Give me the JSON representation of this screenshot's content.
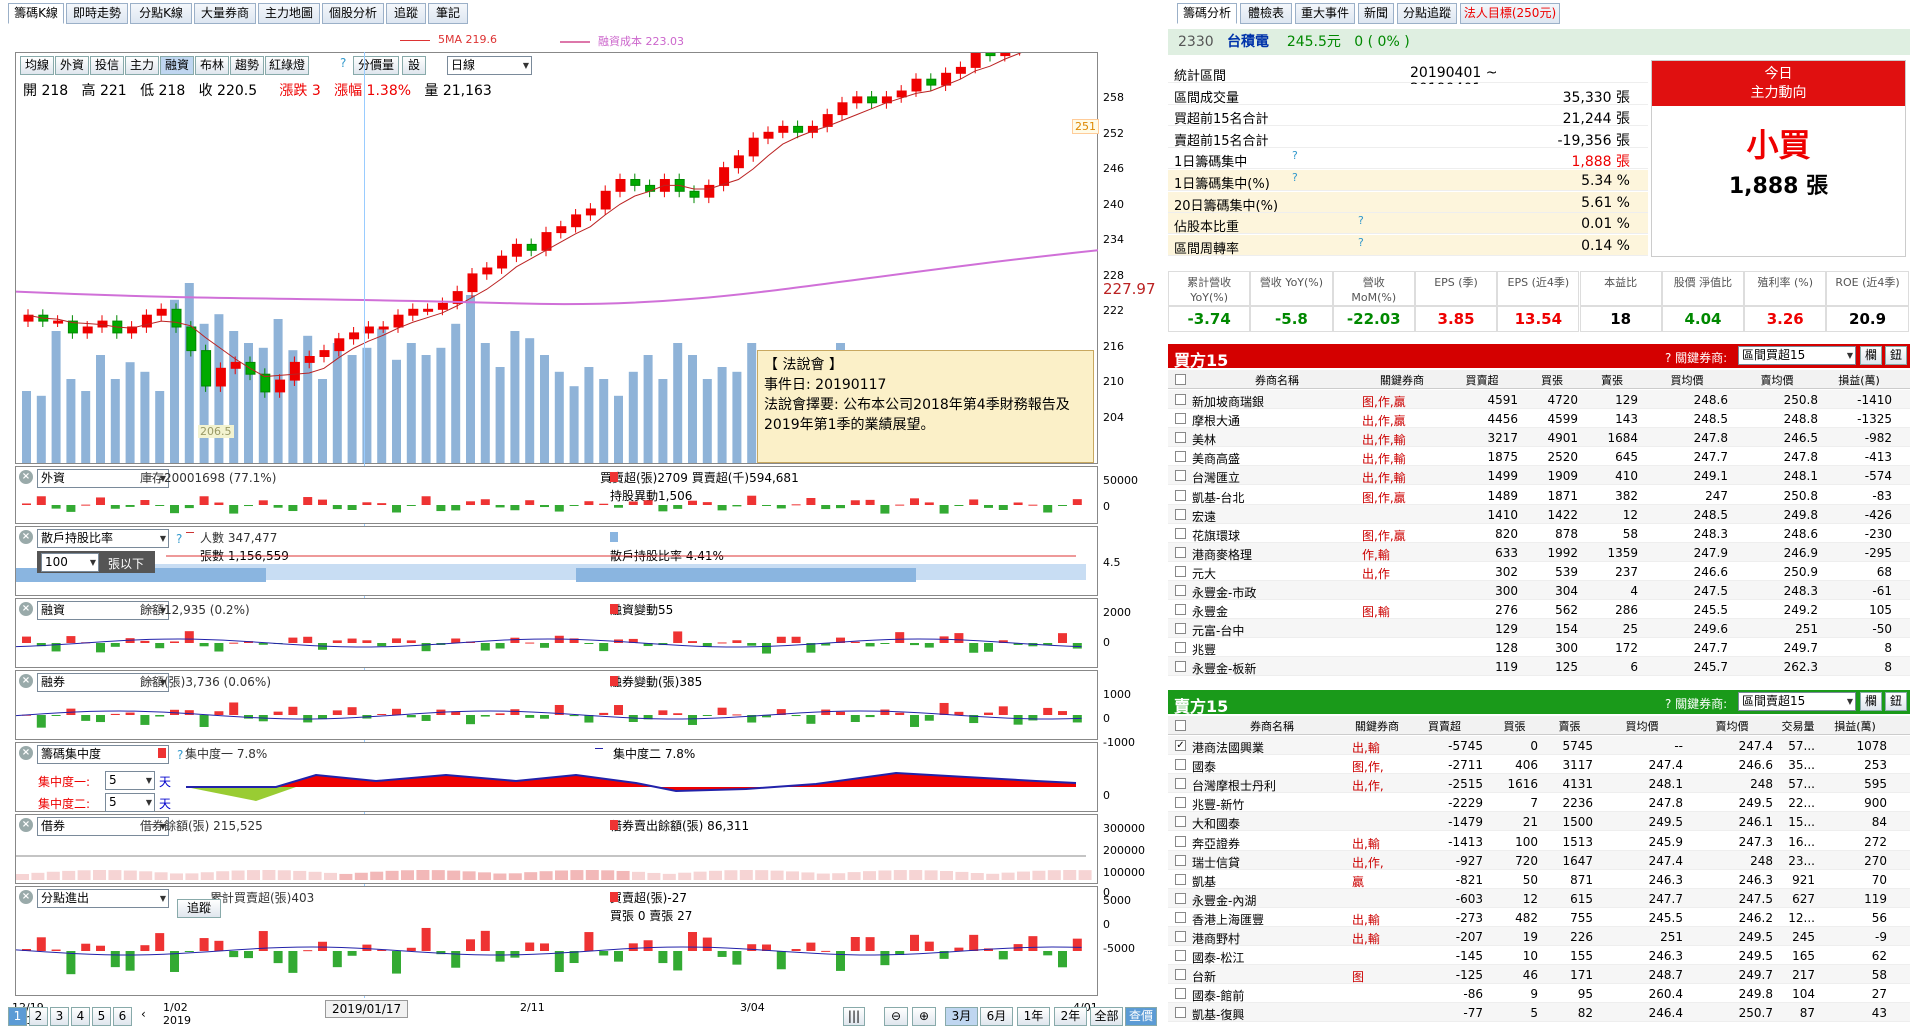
{
  "left_tabs": [
    "籌碼K線",
    "即時走勢",
    "分點K線",
    "大量券商",
    "主力地圖",
    "個股分析",
    "追蹤",
    "筆記"
  ],
  "legend": {
    "ma5": "5MA 219.6",
    "margin_cost": "融資成本 223.03"
  },
  "toolbar": {
    "buttons": [
      "均線",
      "外資",
      "投信",
      "主力",
      "融資",
      "布林",
      "趨勢",
      "紅綠燈"
    ],
    "help": "?",
    "volume_btn": "分價量",
    "settings_btn": "設",
    "period": "日線"
  },
  "ohlc": {
    "open": "開 218",
    "high": "高 221",
    "low": "低 218",
    "close": "收 220.5",
    "change": "漲跌 3",
    "pct": "漲幅 1.38%",
    "volume": "量 21,163"
  },
  "price_axis": [
    "258",
    "252",
    "246",
    "240",
    "234",
    "228",
    "222",
    "216",
    "210",
    "204"
  ],
  "price_marker": "227.97",
  "last_price_tag": "251",
  "low_tag": "206.5",
  "tooltip": {
    "title": "【 法說會 】",
    "date": "事件日: 20190117",
    "desc": "法說會擇要: 公布本公司2018年第4季財務報告及2019年第1季的業績展望。"
  },
  "p1": {
    "select": "外資",
    "l1": "庫存20001698 (77.1%)",
    "l2": "買賣超(張)2709 買賣超(千)594,681",
    "l3": "持股異動1,506",
    "y": [
      "50000",
      "0"
    ]
  },
  "p2": {
    "select": "散戶持股比率",
    "help": "?",
    "sub": "100",
    "unit": "張以下",
    "l1": "人數 347,477",
    "l2": "張數 1,156,559",
    "l3": "散戶持股比率 4.41%",
    "y": [
      "4.5"
    ]
  },
  "p3": {
    "select": "融資",
    "l1": "餘額12,935 (0.2%)",
    "l2": "融資變動55",
    "y": [
      "2000",
      "0"
    ]
  },
  "p4": {
    "select": "融券",
    "l1": "餘額(張)3,736 (0.06%)",
    "l2": "融券變動(張)385",
    "y": [
      "1000",
      "0",
      "-1000"
    ]
  },
  "p5": {
    "select": "籌碼集中度",
    "help": "?",
    "l1": "集中度一 7.8%",
    "l2": "集中度二 7.8%",
    "c1": "集中度一:",
    "c2": "集中度二:",
    "v1": "5",
    "v2": "5",
    "day": "天",
    "y": [
      "0"
    ]
  },
  "p6": {
    "select": "借券",
    "l1": "借券餘額(張) 215,525",
    "l2": "借券賣出餘額(張) 86,311",
    "y": [
      "300000",
      "200000",
      "100000",
      "0"
    ]
  },
  "p7": {
    "select": "分點進出",
    "track": "追蹤",
    "l1": "累計買賣超(張)403",
    "l2": "買賣超(張)-27",
    "l3": "買張 0 賣張 27",
    "y": [
      "5000",
      "0",
      "-5000"
    ]
  },
  "xaxis": [
    {
      "t": "12/19",
      "s": "2018"
    },
    {
      "t": "1/02",
      "s": "2019"
    },
    {
      "t": "2/11",
      "s": ""
    },
    {
      "t": "3/04",
      "s": ""
    },
    {
      "t": "4/01",
      "s": ""
    }
  ],
  "xcursor": "2019/01/17",
  "bottom": {
    "pages": [
      "1",
      "2",
      "3",
      "4",
      "5",
      "6"
    ],
    "ranges": [
      "3月",
      "6月",
      "1年",
      "2年",
      "全部"
    ],
    "query": "查價"
  },
  "right_tabs": [
    "籌碼分析",
    "體檢表",
    "重大事件",
    "新聞",
    "分點追蹤",
    "法人目標(250元)"
  ],
  "stock": {
    "code": "2330",
    "name": "台積電",
    "price": "245.5元",
    "chg": "0 ( 0% )"
  },
  "stats": [
    {
      "k": "統計區間",
      "v": "20190401 ~ 20190401"
    },
    {
      "k": "區間成交量",
      "v": "35,330 張"
    },
    {
      "k": "買超前15名合計",
      "v": "21,244 張"
    },
    {
      "k": "賣超前15名合計",
      "v": "-19,356 張"
    },
    {
      "k": "1日籌碼集中",
      "v": "1,888 張"
    },
    {
      "k": "1日籌碼集中(%)",
      "v": "5.34 %"
    },
    {
      "k": "20日籌碼集中(%)",
      "v": "5.61 %"
    },
    {
      "k": "佔股本比重",
      "v": "0.01 %"
    },
    {
      "k": "區間周轉率",
      "v": "0.14 %"
    }
  ],
  "today": {
    "title1": "今日",
    "title2": "主力動向",
    "action": "小買",
    "amount": "1,888 張"
  },
  "fin_head": [
    "累計營收 YoY(%)",
    "營收 YoY(%)",
    "營收 MoM(%)",
    "EPS (季)",
    "EPS (近4季)",
    "本益比",
    "股價 淨值比",
    "殖利率 (%)",
    "ROE (近4季)"
  ],
  "fin_vals": [
    "-3.74",
    "-5.8",
    "-22.03",
    "3.85",
    "13.54",
    "18",
    "4.04",
    "3.26",
    "20.9"
  ],
  "buy": {
    "title": "買方15",
    "kw": "? 關鍵券商:",
    "sel": "區間買超15",
    "b1": "欄",
    "b2": "鈕",
    "cols": [
      "券商名稱",
      "關鍵券商",
      "買賣超",
      "買張",
      "賣張",
      "買均價",
      "賣均價",
      "損益(萬)"
    ],
    "rows": [
      [
        "新加坡商瑞銀",
        "图,作,贏",
        "4591",
        "4720",
        "129",
        "248.6",
        "250.8",
        "-1410"
      ],
      [
        "摩根大通",
        "出,作,贏",
        "4456",
        "4599",
        "143",
        "248.5",
        "248.8",
        "-1325"
      ],
      [
        "美林",
        "出,作,輸",
        "3217",
        "4901",
        "1684",
        "247.8",
        "246.5",
        "-982"
      ],
      [
        "美商高盛",
        "出,作,輸",
        "1875",
        "2520",
        "645",
        "247.7",
        "247.8",
        "-413"
      ],
      [
        "台灣匯立",
        "出,作,輸",
        "1499",
        "1909",
        "410",
        "249.1",
        "248.1",
        "-574"
      ],
      [
        "凱基-台北",
        "图,作,贏",
        "1489",
        "1871",
        "382",
        "247",
        "250.8",
        "-83"
      ],
      [
        "宏遠",
        "",
        "1410",
        "1422",
        "12",
        "248.5",
        "249.8",
        "-426"
      ],
      [
        "花旗環球",
        "图,作,贏",
        "820",
        "878",
        "58",
        "248.3",
        "248.6",
        "-230"
      ],
      [
        "港商麥格理",
        "作,輸",
        "633",
        "1992",
        "1359",
        "247.9",
        "246.9",
        "-295"
      ],
      [
        "元大",
        "出,作",
        "302",
        "539",
        "237",
        "246.6",
        "250.9",
        "68"
      ],
      [
        "永豐金-市政",
        "",
        "300",
        "304",
        "4",
        "247.5",
        "248.3",
        "-61"
      ],
      [
        "永豐金",
        "图,輸",
        "276",
        "562",
        "286",
        "245.5",
        "249.2",
        "105"
      ],
      [
        "元富-台中",
        "",
        "129",
        "154",
        "25",
        "249.6",
        "251",
        "-50"
      ],
      [
        "兆豐",
        "",
        "128",
        "300",
        "172",
        "247.7",
        "249.7",
        "8"
      ],
      [
        "永豐金-板新",
        "",
        "119",
        "125",
        "6",
        "245.7",
        "262.3",
        "8"
      ]
    ]
  },
  "sell": {
    "title": "賣方15",
    "kw": "? 關鍵券商:",
    "sel": "區間賣超15",
    "b1": "欄",
    "b2": "鈕",
    "cols": [
      "券商名稱",
      "關鍵券商",
      "買賣超",
      "買張",
      "賣張",
      "買均價",
      "賣均價",
      "交易量",
      "損益(萬)"
    ],
    "rows": [
      [
        "港商法國興業",
        "出,輸",
        "-5745",
        "0",
        "5745",
        "--",
        "247.4",
        "57...",
        "1078"
      ],
      [
        "國泰",
        "图,作,",
        "-2711",
        "406",
        "3117",
        "247.4",
        "246.6",
        "35...",
        "253"
      ],
      [
        "台灣摩根士丹利",
        "出,作,",
        "-2515",
        "1616",
        "4131",
        "248.1",
        "248",
        "57...",
        "595"
      ],
      [
        "兆豐-新竹",
        "",
        "-2229",
        "7",
        "2236",
        "247.8",
        "249.5",
        "22...",
        "900"
      ],
      [
        "大和國泰",
        "",
        "-1479",
        "21",
        "1500",
        "249.5",
        "246.1",
        "15...",
        "84"
      ],
      [
        "奔亞證券",
        "出,輸",
        "-1413",
        "100",
        "1513",
        "245.9",
        "247.3",
        "16...",
        "272"
      ],
      [
        "瑞士信貸",
        "出,作,",
        "-927",
        "720",
        "1647",
        "247.4",
        "248",
        "23...",
        "270"
      ],
      [
        "凱基",
        "贏",
        "-821",
        "50",
        "871",
        "246.3",
        "246.3",
        "921",
        "70"
      ],
      [
        "永豐金-內湖",
        "",
        "-603",
        "12",
        "615",
        "247.7",
        "247.5",
        "627",
        "119"
      ],
      [
        "香港上海匯豐",
        "出,輸",
        "-273",
        "482",
        "755",
        "245.5",
        "246.2",
        "12...",
        "56"
      ],
      [
        "港商野村",
        "出,輸",
        "-207",
        "19",
        "226",
        "251",
        "249.5",
        "245",
        "-9"
      ],
      [
        "國泰-松江",
        "",
        "-145",
        "10",
        "155",
        "246.3",
        "249.5",
        "165",
        "62"
      ],
      [
        "台新",
        "图",
        "-125",
        "46",
        "171",
        "248.7",
        "249.7",
        "217",
        "58"
      ],
      [
        "國泰-館前",
        "",
        "-86",
        "9",
        "95",
        "260.4",
        "249.8",
        "104",
        "27"
      ],
      [
        "凱基-復興",
        "",
        "-77",
        "5",
        "82",
        "246.4",
        "250.7",
        "87",
        "43"
      ]
    ]
  }
}
